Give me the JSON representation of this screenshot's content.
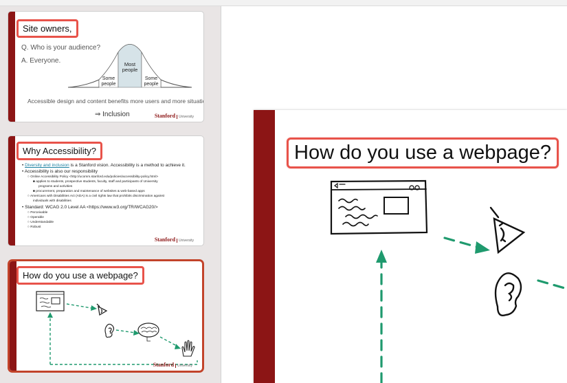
{
  "slides": [
    {
      "title": "Site owners,",
      "question": "Q. Who is your audience?",
      "answer": "A. Everyone.",
      "curve_labels": {
        "left": "Some\npeople",
        "center": "Most\npeople",
        "right": "Some\npeople"
      },
      "caption": "Accessible design and content benefits more users and more situations.",
      "conclusion": "⇒ Inclusion",
      "logo": "Stanford",
      "logo_sub": "University"
    },
    {
      "title": "Why Accessibility?",
      "bullets": [
        "Diversity and inclusion is a Stanford vision.  Accessibility is a method to achieve it.",
        "Accessibility is also our responsibility",
        "Online Accessibility Policy <http://ucomm.stanford.edu/policies/accessibility-policy.html>",
        "applies to students, prospective students, faculty, staff and participants of University",
        "programs and activities",
        "procurement, preparation and maintenance of websites & web-based apps",
        "Americans with Disabilities Act (ADA) is a civil rights law that prohibits discrimination against",
        "individuals with disabilities",
        "Standard: WCAG 2.0 Level AA <https://www.w3.org/TR/WCAG20/>",
        "Perceivable",
        "Operable",
        "Understandable",
        "Robust"
      ],
      "logo": "Stanford",
      "logo_sub": "University"
    },
    {
      "title": "How do you use a webpage?",
      "logo": "Stanford",
      "logo_sub": "University"
    }
  ],
  "main_slide": {
    "title": "How do you use a webpage?"
  },
  "colors": {
    "stanford_red": "#8c1515",
    "highlight": "#e8534a",
    "arrow_green": "#1f9a6e",
    "selected_border": "#c2432a"
  },
  "icons": [
    "browser-sketch-icon",
    "eye-icon",
    "ear-icon",
    "brain-icon",
    "hand-icon"
  ]
}
